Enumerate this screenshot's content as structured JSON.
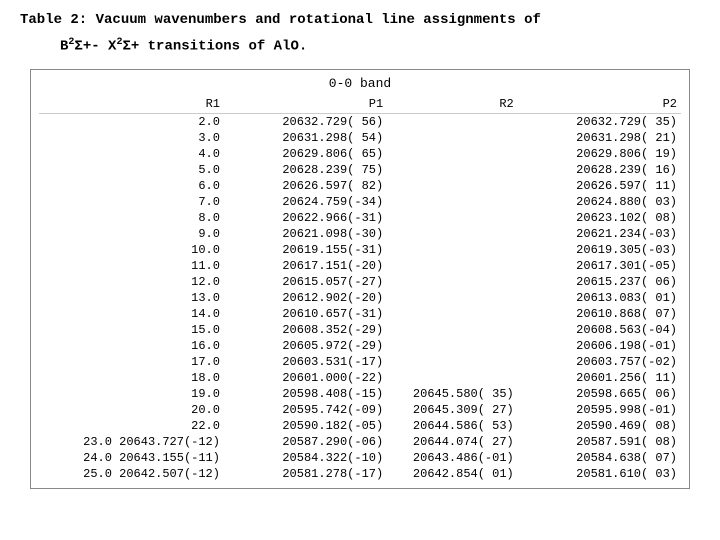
{
  "title": "Table 2: Vacuum wavenumbers and rotational line assignments of",
  "subtitle": "B²Σ+- X²Σ+ transitions of AlO.",
  "band_header": "0-0 band",
  "columns": [
    "R1",
    "P1",
    "R2",
    "P2"
  ],
  "rows": [
    {
      "r1": "2.0",
      "p1": "20632.729( 56)",
      "r2": "",
      "p2": "20632.729( 35)"
    },
    {
      "r1": "3.0",
      "p1": "20631.298( 54)",
      "r2": "",
      "p2": "20631.298( 21)"
    },
    {
      "r1": "4.0",
      "p1": "20629.806( 65)",
      "r2": "",
      "p2": "20629.806( 19)"
    },
    {
      "r1": "5.0",
      "p1": "20628.239( 75)",
      "r2": "",
      "p2": "20628.239( 16)"
    },
    {
      "r1": "6.0",
      "p1": "20626.597( 82)",
      "r2": "",
      "p2": "20626.597( 11)"
    },
    {
      "r1": "7.0",
      "p1": "20624.759(-34)",
      "r2": "",
      "p2": "20624.880( 03)"
    },
    {
      "r1": "8.0",
      "p1": "20622.966(-31)",
      "r2": "",
      "p2": "20623.102( 08)"
    },
    {
      "r1": "9.0",
      "p1": "20621.098(-30)",
      "r2": "",
      "p2": "20621.234(-03)"
    },
    {
      "r1": "10.0",
      "p1": "20619.155(-31)",
      "r2": "",
      "p2": "20619.305(-03)"
    },
    {
      "r1": "11.0",
      "p1": "20617.151(-20)",
      "r2": "",
      "p2": "20617.301(-05)"
    },
    {
      "r1": "12.0",
      "p1": "20615.057(-27)",
      "r2": "",
      "p2": "20615.237( 06)"
    },
    {
      "r1": "13.0",
      "p1": "20612.902(-20)",
      "r2": "",
      "p2": "20613.083( 01)"
    },
    {
      "r1": "14.0",
      "p1": "20610.657(-31)",
      "r2": "",
      "p2": "20610.868( 07)"
    },
    {
      "r1": "15.0",
      "p1": "20608.352(-29)",
      "r2": "",
      "p2": "20608.563(-04)"
    },
    {
      "r1": "16.0",
      "p1": "20605.972(-29)",
      "r2": "",
      "p2": "20606.198(-01)"
    },
    {
      "r1": "17.0",
      "p1": "20603.531(-17)",
      "r2": "",
      "p2": "20603.757(-02)"
    },
    {
      "r1": "18.0",
      "p1": "20601.000(-22)",
      "r2": "",
      "p2": "20601.256( 11)"
    },
    {
      "r1": "19.0",
      "p1": "20598.408(-15)",
      "r2": "20645.580( 35)",
      "p2": "20598.665( 06)"
    },
    {
      "r1": "20.0",
      "p1": "20595.742(-09)",
      "r2": "20645.309( 27)",
      "p2": "20595.998(-01)"
    },
    {
      "r1": "22.0",
      "p1": "20590.182(-05)",
      "r2": "20644.586( 53)",
      "p2": "20590.469( 08)"
    },
    {
      "r1": "23.0",
      "p1": "20587.290(-06)",
      "r2": "20644.074( 27)",
      "p2": "20587.591( 08)"
    },
    {
      "r1": "24.0",
      "p1": "20584.322(-10)",
      "r2": "20643.486(-01)",
      "p2": "20584.638( 07)"
    },
    {
      "r1": "25.0",
      "p1": "20581.278(-17)",
      "r2": "20642.854( 01)",
      "p2": "20581.610( 03)"
    }
  ],
  "row_r1_special": {
    "23.0": "20643.727(-12)",
    "24.0": "20643.155(-11)",
    "25.0": "20642.507(-12)"
  }
}
